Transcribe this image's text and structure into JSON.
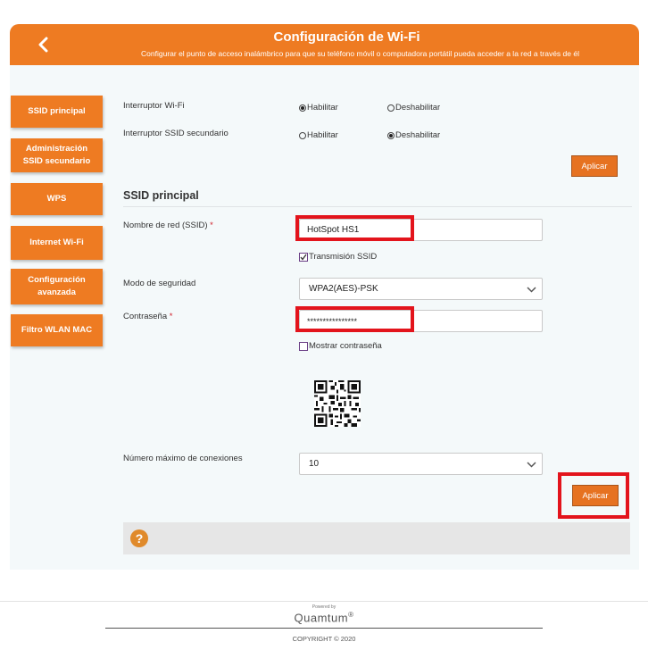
{
  "header": {
    "title": "Configuración de Wi-Fi",
    "subtitle": "Configurar el punto de acceso inalámbrico para que su teléfono móvil o computadora portátil pueda acceder a la red a través de él",
    "back_icon": "chevron-left-icon"
  },
  "sidebar": {
    "items": [
      {
        "label": "SSID principal"
      },
      {
        "label": "Administración SSID secundario"
      },
      {
        "label": "WPS"
      },
      {
        "label": "Internet Wi-Fi"
      },
      {
        "label": "Configuración avanzada"
      },
      {
        "label": "Filtro WLAN MAC"
      }
    ]
  },
  "switches": {
    "wifi_label": "Interruptor Wi-Fi",
    "secondary_label": "Interruptor SSID secundario",
    "enable": "Habilitar",
    "disable": "Deshabilitar",
    "wifi_selected": "Habilitar",
    "secondary_selected": "Deshabilitar"
  },
  "apply_label": "Aplicar",
  "ssid": {
    "section_title": "SSID principal",
    "network_label": "Nombre de red (SSID)",
    "required_mark": "*",
    "network_value": "HotSpot HS1",
    "broadcast_label": "Transmisión SSID",
    "broadcast_checked": true,
    "security_label": "Modo de seguridad",
    "security_value": "WPA2(AES)-PSK",
    "password_label": "Contraseña",
    "password_value": "****************",
    "show_password_label": "Mostrar contraseña",
    "show_password_checked": false,
    "max_conn_label": "Número máximo de conexiones",
    "max_conn_value": "10"
  },
  "help_icon": "question-icon",
  "footer": {
    "powered_by": "Powered by",
    "brand": "Quamtum",
    "brand_mark": "®",
    "copyright": "COPYRIGHT © 2020"
  },
  "colors": {
    "accent": "#ee7b22",
    "highlight": "#e3141c"
  }
}
